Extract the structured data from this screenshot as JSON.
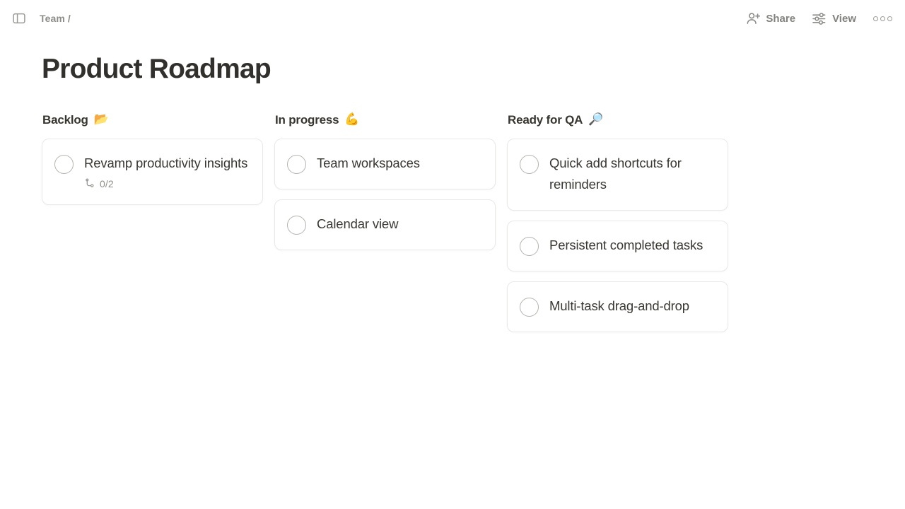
{
  "topbar": {
    "sidebar_toggle_icon": "sidebar-panel-icon",
    "breadcrumb": "Team /",
    "share_label": "Share",
    "share_icon": "person-add-icon",
    "view_label": "View",
    "view_icon": "sliders-icon",
    "more_icon": "more-horizontal-icon"
  },
  "page": {
    "title": "Product Roadmap"
  },
  "board": {
    "columns": [
      {
        "title": "Backlog",
        "emoji": "📂",
        "emoji_name": "open-folder-emoji",
        "cards": [
          {
            "title": "Revamp productivity insights",
            "subtasks": "0/2",
            "subtask_icon": "subtask-branch-icon"
          }
        ]
      },
      {
        "title": "In progress",
        "emoji": "💪",
        "emoji_name": "flexed-biceps-emoji",
        "cards": [
          {
            "title": "Team workspaces"
          },
          {
            "title": "Calendar view"
          }
        ]
      },
      {
        "title": "Ready for QA",
        "emoji": "🔎",
        "emoji_name": "magnifying-glass-emoji",
        "cards": [
          {
            "title": "Quick add shortcuts for reminders"
          },
          {
            "title": "Persistent completed tasks"
          },
          {
            "title": "Multi-task drag-and-drop"
          }
        ]
      }
    ]
  },
  "colors": {
    "text": "#37352f",
    "muted": "#83827e",
    "border": "#e9e9e7",
    "background": "#ffffff"
  }
}
